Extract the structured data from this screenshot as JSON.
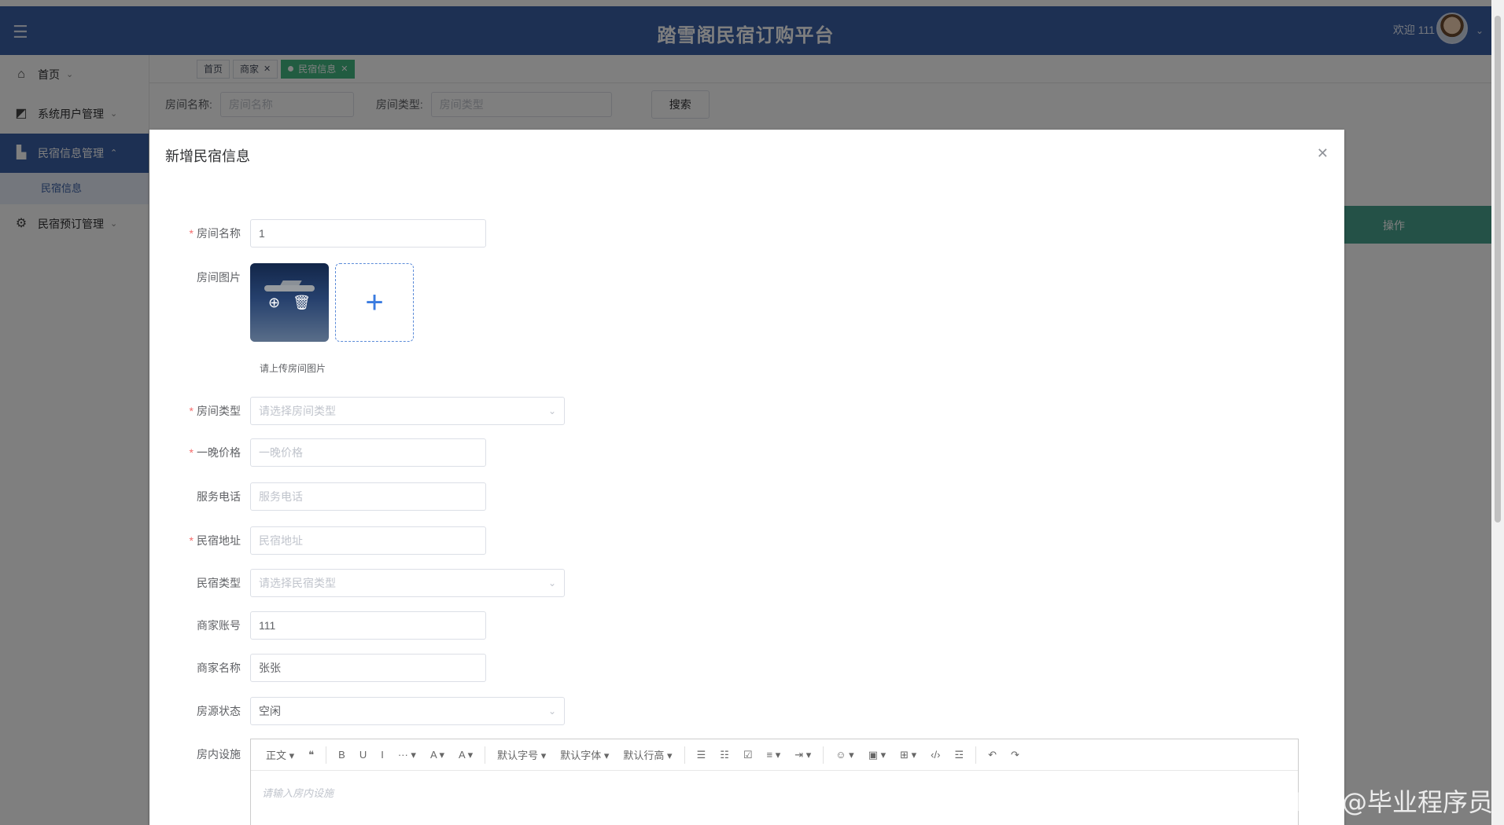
{
  "header": {
    "title": "踏雪阁民宿订购平台",
    "welcome": "欢迎 111"
  },
  "sidebar": {
    "items": [
      {
        "label": "首页",
        "icon": "home-icon"
      },
      {
        "label": "系统用户管理",
        "icon": "user-admin-icon"
      },
      {
        "label": "民宿信息管理",
        "icon": "building-icon"
      },
      {
        "label": "民宿预订管理",
        "icon": "chip-icon"
      }
    ],
    "sub_item": "民宿信息"
  },
  "tabs": [
    "首页",
    "商家",
    "民宿信息"
  ],
  "filters": {
    "room_name_label": "房间名称:",
    "room_name_placeholder": "房间名称",
    "room_type_label": "房间类型:",
    "room_type_placeholder": "房间类型",
    "search_button": "搜索"
  },
  "table": {
    "op_header": "操作"
  },
  "dialog": {
    "title": "新增民宿信息",
    "fields": {
      "room_name": {
        "label": "房间名称",
        "value": "1"
      },
      "room_image": {
        "label": "房间图片",
        "hint": "请上传房间图片"
      },
      "room_type": {
        "label": "房间类型",
        "placeholder": "请选择房间类型"
      },
      "price": {
        "label": "一晚价格",
        "placeholder": "一晚价格"
      },
      "phone": {
        "label": "服务电话",
        "placeholder": "服务电话"
      },
      "address": {
        "label": "民宿地址",
        "placeholder": "民宿地址"
      },
      "homestay_type": {
        "label": "民宿类型",
        "placeholder": "请选择民宿类型"
      },
      "merchant_account": {
        "label": "商家账号",
        "value": "111"
      },
      "merchant_name": {
        "label": "商家名称",
        "value": "张张"
      },
      "status": {
        "label": "房源状态",
        "value": "空闲"
      },
      "facilities": {
        "label": "房内设施",
        "placeholder": "请输入房内设施"
      }
    },
    "editor_toolbar": [
      "正文 ▾",
      "❝",
      "B",
      "U",
      "I",
      "··· ▾",
      "A ▾",
      "A ▾",
      "默认字号 ▾",
      "默认字体 ▾",
      "默认行高 ▾",
      "☰",
      "☷",
      "☑",
      "≡ ▾",
      "⇥ ▾",
      "☺ ▾",
      "▣ ▾",
      "⊞ ▾",
      "‹/›",
      "☲",
      "↶",
      "↷"
    ]
  },
  "watermark": "CSDN @毕业程序员",
  "colors": {
    "primary": "#3a60a6",
    "tab_active": "#42b983",
    "table_header": "#49a38f",
    "required": "#f56c6c"
  }
}
